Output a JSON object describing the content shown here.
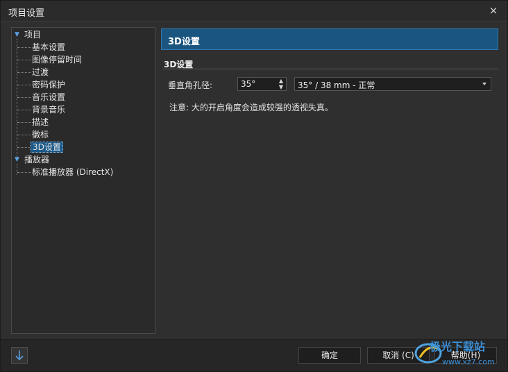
{
  "window": {
    "title": "项目设置",
    "close_glyph": "×"
  },
  "tree": {
    "root1": "项目",
    "items": [
      "基本设置",
      "图像停留时间",
      "过渡",
      "密码保护",
      "音乐设置",
      "背景音乐",
      "描述",
      "徽标",
      "3D设置"
    ],
    "selected_index": 8,
    "root2": "播放器",
    "root2_items": [
      "标准播放器 (DirectX)"
    ]
  },
  "panel": {
    "header": "3D设置",
    "section_title": "3D设置",
    "field_label": "垂直角孔径:",
    "spin_value": "35°",
    "select_value": "35° / 38 mm - 正常",
    "note": "注意: 大的开启角度会造成较强的透视失真。"
  },
  "buttons": {
    "ok": "确定",
    "cancel": "取消 (C)",
    "help": "帮助(H)"
  },
  "watermark": {
    "text1": "极光下载站",
    "text2": "www.xz7.com"
  },
  "colors": {
    "accent": "#1a5580",
    "selection": "#1c5a8a"
  },
  "icons": {
    "bottom_left": "arrow-down-icon",
    "tree_expander": "expanded-triangle-icon"
  }
}
